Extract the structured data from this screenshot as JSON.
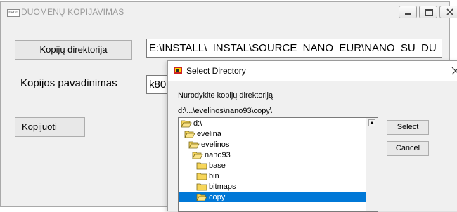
{
  "main_window": {
    "icon_text": "nano",
    "title": "DUOMENŲ KOPIJAVIMAS",
    "dir_button_label": "Kopijų direktorija",
    "dir_path": "E:\\INSTALL\\_INSTAL\\SOURCE_NANO_EUR\\NANO_SU_DU",
    "name_label": "Kopijos pavadinimas",
    "name_value": "k80",
    "copy_button_label_first": "K",
    "copy_button_label_rest": "opijuoti"
  },
  "dialog": {
    "title": "Select Directory",
    "prompt": "Nurodykite kopijų direktoriją",
    "current_path": "d:\\...\\evelinos\\nano93\\copy\\",
    "tree_items": [
      {
        "label": "d:\\",
        "open": true
      },
      {
        "label": "evelina",
        "open": true
      },
      {
        "label": "evelinos",
        "open": true
      },
      {
        "label": "nano93",
        "open": true
      },
      {
        "label": "base",
        "open": false
      },
      {
        "label": "bin",
        "open": false
      },
      {
        "label": "bitmaps",
        "open": false
      },
      {
        "label": "copy",
        "open": true,
        "selected": true
      }
    ],
    "select_label": "Select",
    "cancel_label": "Cancel"
  },
  "colors": {
    "selection": "#0078d7",
    "folder": "#f7d65a"
  }
}
